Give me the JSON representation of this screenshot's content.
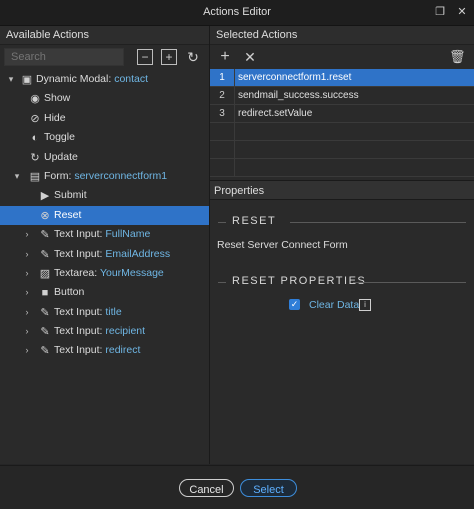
{
  "window": {
    "title": "Actions Editor"
  },
  "left_panel": {
    "header": "Available Actions",
    "search_placeholder": "Search",
    "tree": [
      {
        "chevron": "▾",
        "icon": "modal-icon",
        "glyph": "▣",
        "label": "Dynamic Modal:",
        "param": "contact",
        "selected": false
      },
      {
        "chevron": "",
        "icon": "eye-icon",
        "glyph": "◉",
        "label": "Show",
        "param": "",
        "selected": false
      },
      {
        "chevron": "",
        "icon": "eye-off-icon",
        "glyph": "⊘",
        "label": "Hide",
        "param": "",
        "selected": false
      },
      {
        "chevron": "",
        "icon": "toggle-icon",
        "glyph": "◐",
        "label": "Toggle",
        "param": "",
        "selected": false
      },
      {
        "chevron": "",
        "icon": "refresh-icon",
        "glyph": "↻",
        "label": "Update",
        "param": "",
        "selected": false
      },
      {
        "chevron": "▾",
        "icon": "form-icon",
        "glyph": "▤",
        "label": "Form:",
        "param": "serverconnectform1",
        "selected": false
      },
      {
        "chevron": "",
        "icon": "play-icon",
        "glyph": "▶",
        "label": "Submit",
        "param": "",
        "selected": false
      },
      {
        "chevron": "",
        "icon": "reset-icon",
        "glyph": "⊗",
        "label": "Reset",
        "param": "",
        "selected": true
      },
      {
        "chevron": "›",
        "icon": "pencil-icon",
        "glyph": "✎",
        "label": "Text Input:",
        "param": "FullName",
        "selected": false
      },
      {
        "chevron": "›",
        "icon": "pencil-icon",
        "glyph": "✎",
        "label": "Text Input:",
        "param": "EmailAddress",
        "selected": false
      },
      {
        "chevron": "›",
        "icon": "textarea-icon",
        "glyph": "▨",
        "label": "Textarea:",
        "param": "YourMessage",
        "selected": false
      },
      {
        "chevron": "›",
        "icon": "button-icon",
        "glyph": "■",
        "label": "Button",
        "param": "",
        "selected": false
      },
      {
        "chevron": "›",
        "icon": "pencil-icon",
        "glyph": "✎",
        "label": "Text Input:",
        "param": "title",
        "selected": false
      },
      {
        "chevron": "›",
        "icon": "pencil-icon",
        "glyph": "✎",
        "label": "Text Input:",
        "param": "recipient",
        "selected": false
      },
      {
        "chevron": "›",
        "icon": "pencil-icon",
        "glyph": "✎",
        "label": "Text Input:",
        "param": "redirect",
        "selected": false
      }
    ]
  },
  "right_panel": {
    "header": "Selected Actions",
    "actions": [
      {
        "num": "1",
        "text": "serverconnectform1.reset",
        "active": true
      },
      {
        "num": "2",
        "text": "sendmail_success.success",
        "active": false
      },
      {
        "num": "3",
        "text": "redirect.setValue",
        "active": false
      },
      {
        "num": "",
        "text": "",
        "active": false
      },
      {
        "num": "",
        "text": "",
        "active": false
      },
      {
        "num": "",
        "text": "",
        "active": false
      }
    ],
    "properties_header": "Properties",
    "section_title": "RESET",
    "description": "Reset Server Connect Form",
    "props_title": "RESET PROPERTIES",
    "clear_data_label": "Clear Data",
    "clear_data_checked": true
  },
  "footer": {
    "cancel_label": "Cancel",
    "select_label": "Select"
  }
}
